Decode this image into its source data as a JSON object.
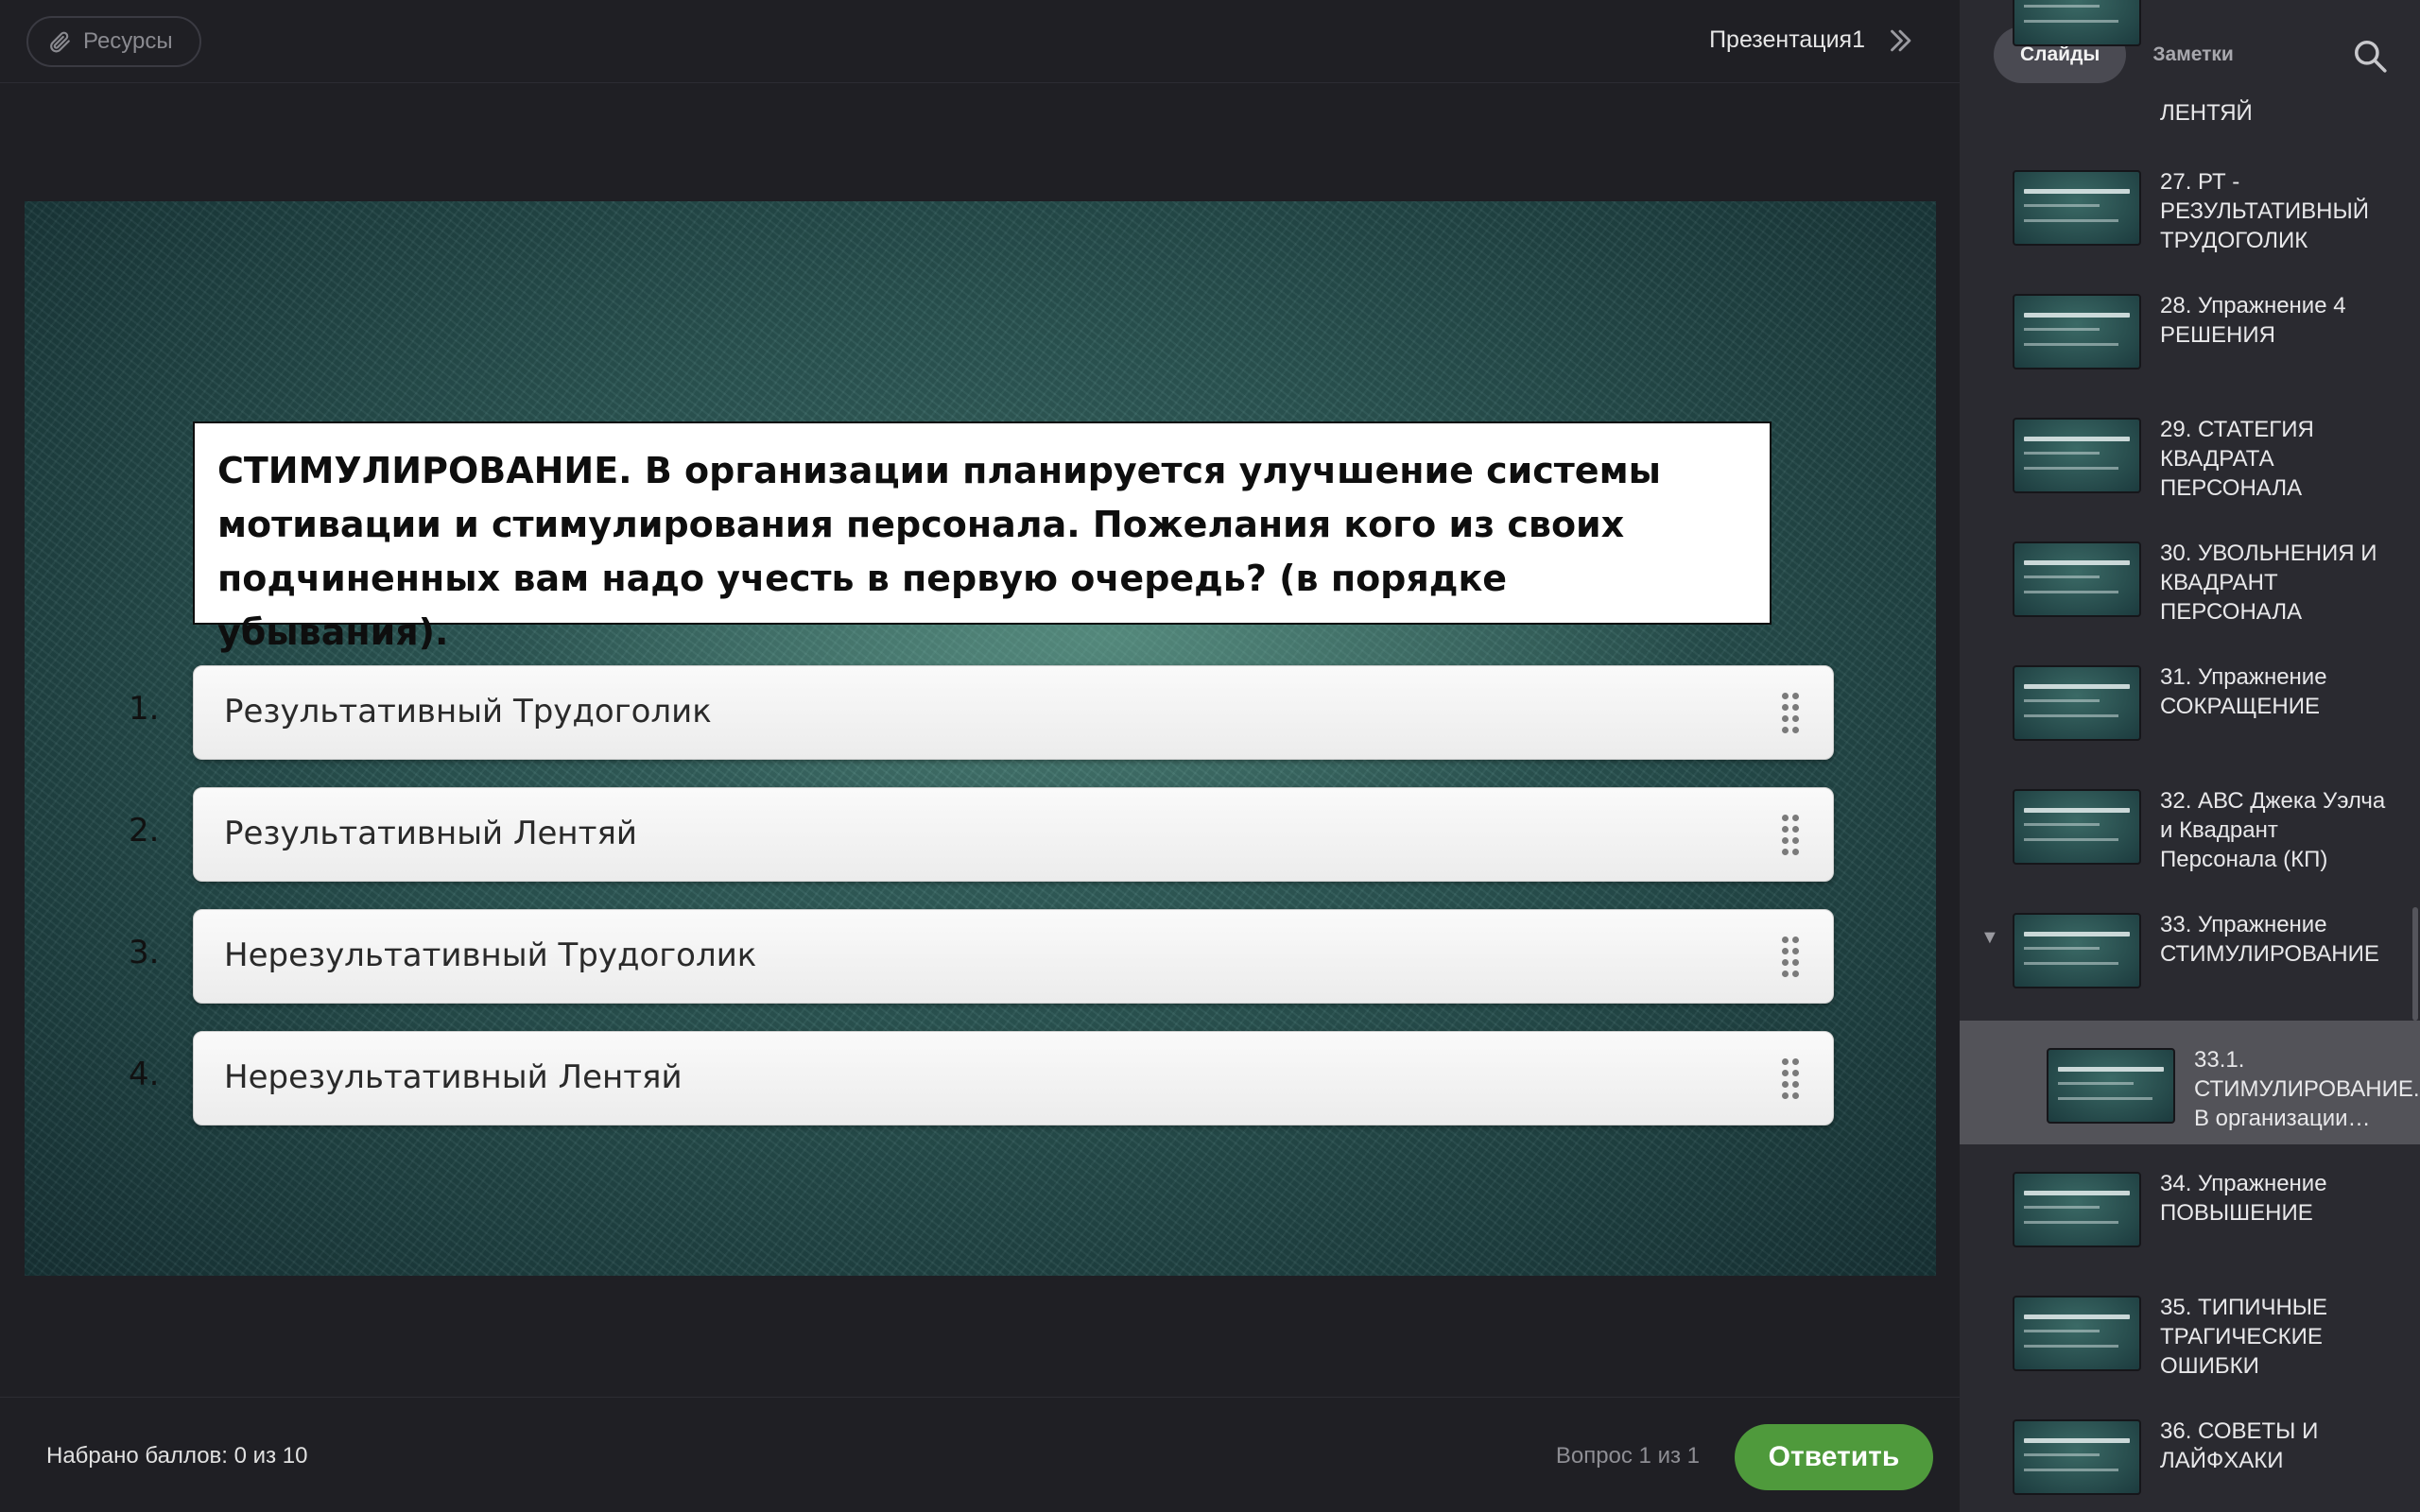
{
  "toolbar": {
    "resources_label": "Ресурсы",
    "presentation_title": "Презентация1"
  },
  "question": {
    "text": "СТИМУЛИРОВАНИЕ. В организации планируется улучшение системы мотивации и стимулирования персонала. Пожелания кого из своих подчиненных вам надо учесть в первую очередь? (в порядке убывания).",
    "answers": [
      {
        "num": "1.",
        "text": "Результативный Трудоголик"
      },
      {
        "num": "2.",
        "text": "Результативный Лентяй"
      },
      {
        "num": "3.",
        "text": "Нерезультативный Трудоголик"
      },
      {
        "num": "4.",
        "text": "Нерезультативный Лентяй"
      }
    ]
  },
  "footer": {
    "score": "Набрано баллов: 0 из 10",
    "question_count": "Вопрос 1 из 1",
    "submit_label": "Ответить"
  },
  "sidebar": {
    "tabs": [
      {
        "label": "Слайды",
        "active": true
      },
      {
        "label": "Заметки",
        "active": false
      }
    ],
    "slides": [
      {
        "label": "ЛЕНТЯЙ"
      },
      {
        "label": "27. РТ - РЕЗУЛЬТАТИВНЫЙ ТРУДОГОЛИК"
      },
      {
        "label": "28. Упражнение 4 РЕШЕНИЯ"
      },
      {
        "label": "29. СТАТЕГИЯ КВАДРАТА ПЕРСОНАЛА"
      },
      {
        "label": "30. УВОЛЬНЕНИЯ И КВАДРАНТ ПЕРСОНАЛА"
      },
      {
        "label": "31. Упражнение СОКРАЩЕНИЕ"
      },
      {
        "label": "32. АВС Джека Уэлча и Квадрант Персонала (КП)"
      },
      {
        "label": "33. Упражнение СТИМУЛИРОВАНИЕ",
        "caret": "▼"
      },
      {
        "label": "33.1. СТИМУЛИРОВАНИЕ. В организации…",
        "active": true
      },
      {
        "label": "34. Упражнение ПОВЫШЕНИЕ"
      },
      {
        "label": "35. ТИПИЧНЫЕ ТРАГИЧЕСКИЕ ОШИБКИ"
      },
      {
        "label": "36. СОВЕТЫ И ЛАЙФХАКИ"
      }
    ]
  },
  "colors": {
    "accent_green": "#4f9a3c",
    "app_bg": "#1f1f24",
    "sidebar_bg": "#2a2a30",
    "active_item": "#535359"
  }
}
